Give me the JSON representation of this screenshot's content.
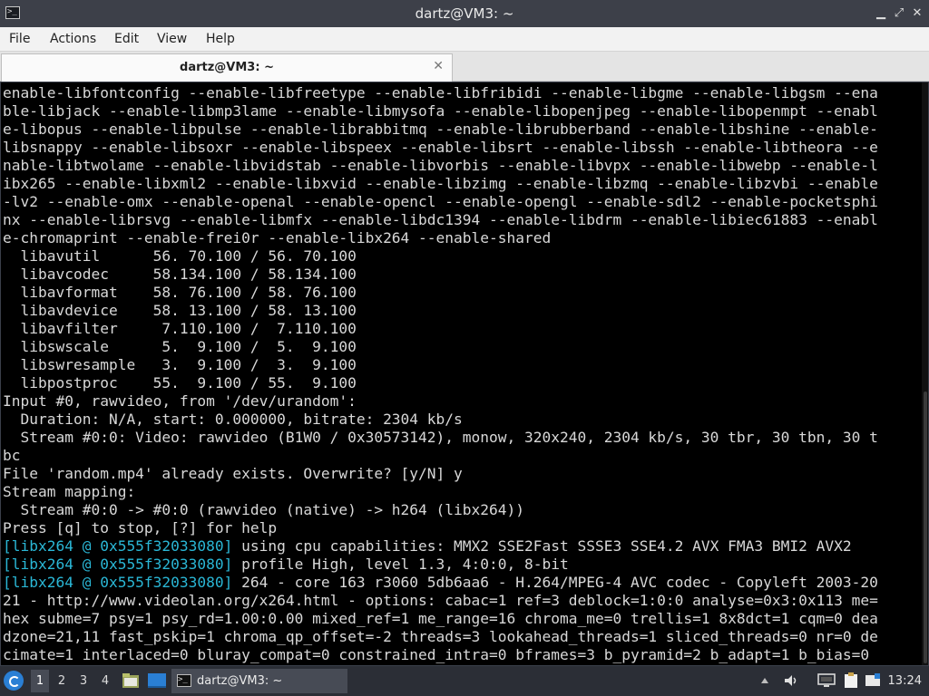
{
  "window": {
    "title": "dartz@VM3: ~",
    "minimize": "▁",
    "maximize": "⤢",
    "close": "✕"
  },
  "menubar": {
    "file": "File",
    "actions": "Actions",
    "edit": "Edit",
    "view": "View",
    "help": "Help"
  },
  "tab": {
    "label": "dartz@VM3: ~",
    "close": "✕"
  },
  "terminal": {
    "lines": [
      {
        "text": "enable-libfontconfig --enable-libfreetype --enable-libfribidi --enable-libgme --enable-libgsm --ena"
      },
      {
        "text": "ble-libjack --enable-libmp3lame --enable-libmysofa --enable-libopenjpeg --enable-libopenmpt --enabl"
      },
      {
        "text": "e-libopus --enable-libpulse --enable-librabbitmq --enable-librubberband --enable-libshine --enable-"
      },
      {
        "text": "libsnappy --enable-libsoxr --enable-libspeex --enable-libsrt --enable-libssh --enable-libtheora --e"
      },
      {
        "text": "nable-libtwolame --enable-libvidstab --enable-libvorbis --enable-libvpx --enable-libwebp --enable-l"
      },
      {
        "text": "ibx265 --enable-libxml2 --enable-libxvid --enable-libzimg --enable-libzmq --enable-libzvbi --enable"
      },
      {
        "text": "-lv2 --enable-omx --enable-openal --enable-opencl --enable-opengl --enable-sdl2 --enable-pocketsphi"
      },
      {
        "text": "nx --enable-librsvg --enable-libmfx --enable-libdc1394 --enable-libdrm --enable-libiec61883 --enabl"
      },
      {
        "text": "e-chromaprint --enable-frei0r --enable-libx264 --enable-shared"
      },
      {
        "text": "  libavutil      56. 70.100 / 56. 70.100"
      },
      {
        "text": "  libavcodec     58.134.100 / 58.134.100"
      },
      {
        "text": "  libavformat    58. 76.100 / 58. 76.100"
      },
      {
        "text": "  libavdevice    58. 13.100 / 58. 13.100"
      },
      {
        "text": "  libavfilter     7.110.100 /  7.110.100"
      },
      {
        "text": "  libswscale      5.  9.100 /  5.  9.100"
      },
      {
        "text": "  libswresample   3.  9.100 /  3.  9.100"
      },
      {
        "text": "  libpostproc    55.  9.100 / 55.  9.100"
      },
      {
        "text": "Input #0, rawvideo, from '/dev/urandom':"
      },
      {
        "text": "  Duration: N/A, start: 0.000000, bitrate: 2304 kb/s"
      },
      {
        "text": "  Stream #0:0: Video: rawvideo (B1W0 / 0x30573142), monow, 320x240, 2304 kb/s, 30 tbr, 30 tbn, 30 t"
      },
      {
        "text": "bc"
      },
      {
        "text": "File 'random.mp4' already exists. Overwrite? [y/N] y"
      },
      {
        "text": "Stream mapping:"
      },
      {
        "text": "  Stream #0:0 -> #0:0 (rawvideo (native) -> h264 (libx264))"
      },
      {
        "text": "Press [q] to stop, [?] for help"
      },
      {
        "tag": "[libx264 @ 0x555f32033080]",
        "text": " using cpu capabilities: MMX2 SSE2Fast SSSE3 SSE4.2 AVX FMA3 BMI2 AVX2"
      },
      {
        "tag": "[libx264 @ 0x555f32033080]",
        "text": " profile High, level 1.3, 4:0:0, 8-bit"
      },
      {
        "tag": "[libx264 @ 0x555f32033080]",
        "text": " 264 - core 163 r3060 5db6aa6 - H.264/MPEG-4 AVC codec - Copyleft 2003-20"
      },
      {
        "text": "21 - http://www.videolan.org/x264.html - options: cabac=1 ref=3 deblock=1:0:0 analyse=0x3:0x113 me="
      },
      {
        "text": "hex subme=7 psy=1 psy_rd=1.00:0.00 mixed_ref=1 me_range=16 chroma_me=0 trellis=1 8x8dct=1 cqm=0 dea"
      },
      {
        "text": "dzone=21,11 fast_pskip=1 chroma_qp_offset=-2 threads=3 lookahead_threads=1 sliced_threads=0 nr=0 de"
      },
      {
        "text": "cimate=1 interlaced=0 bluray_compat=0 constrained_intra=0 bframes=3 b_pyramid=2 b_adapt=1 b_bias=0"
      }
    ]
  },
  "taskbar": {
    "workspaces": [
      "1",
      "2",
      "3",
      "4"
    ],
    "active_workspace": "1",
    "task_label": "dartz@VM3: ~",
    "clock": "13:24"
  },
  "colors": {
    "tag": "#2ab7d6",
    "terminal_bg": "#000000",
    "terminal_fg": "#d8d8d8",
    "titlebar_bg": "#3d4049",
    "start_button": "#2a7fd4"
  }
}
